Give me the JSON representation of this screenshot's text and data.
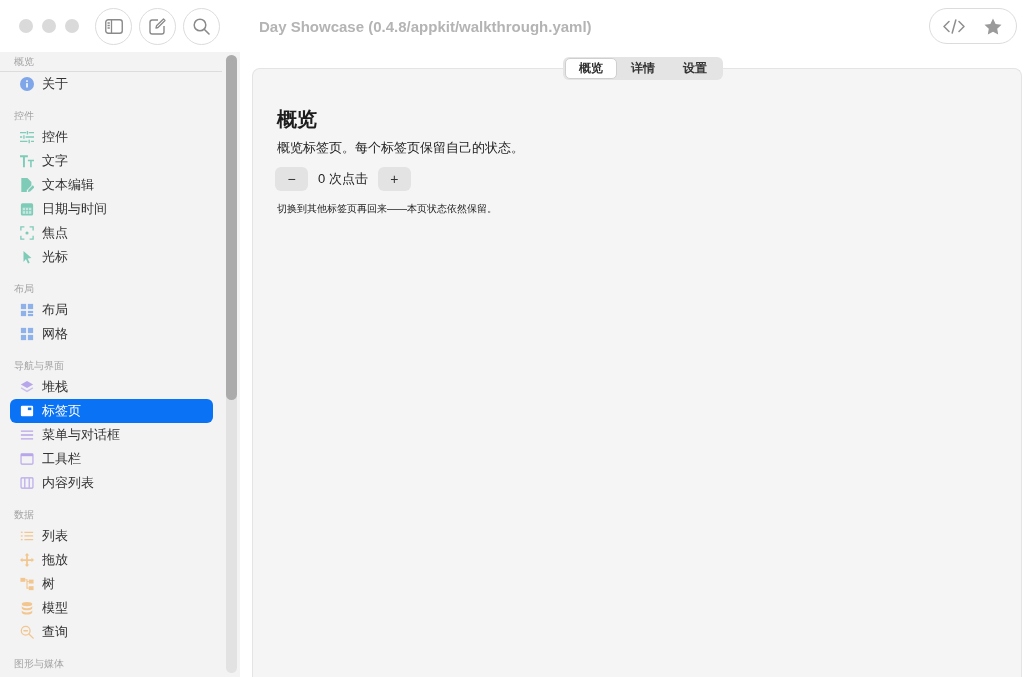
{
  "window": {
    "title": "Day Showcase (0.4.8/appkit/walkthrough.yaml)"
  },
  "sidebar": {
    "sections": [
      {
        "title": "概览",
        "color": "#7ea6e9",
        "items": [
          {
            "label": "关于",
            "selected": false
          }
        ]
      },
      {
        "title": "控件",
        "color": "#7ecbb8",
        "items": [
          {
            "label": "控件",
            "selected": false
          },
          {
            "label": "文字",
            "selected": false
          },
          {
            "label": "文本编辑",
            "selected": false
          },
          {
            "label": "日期与时间",
            "selected": false
          },
          {
            "label": "焦点",
            "selected": false
          },
          {
            "label": "光标",
            "selected": false
          }
        ]
      },
      {
        "title": "布局",
        "color": "#8fb1ea",
        "items": [
          {
            "label": "布局",
            "selected": false
          },
          {
            "label": "网格",
            "selected": false
          }
        ]
      },
      {
        "title": "导航与界面",
        "color": "#b7a6ea",
        "items": [
          {
            "label": "堆栈",
            "selected": false
          },
          {
            "label": "标签页",
            "selected": true
          },
          {
            "label": "菜单与对话框",
            "selected": false
          },
          {
            "label": "工具栏",
            "selected": false
          },
          {
            "label": "内容列表",
            "selected": false
          }
        ]
      },
      {
        "title": "数据",
        "color": "#f2c690",
        "items": [
          {
            "label": "列表",
            "selected": false
          },
          {
            "label": "拖放",
            "selected": false
          },
          {
            "label": "树",
            "selected": false
          },
          {
            "label": "模型",
            "selected": false
          },
          {
            "label": "查询",
            "selected": false
          }
        ]
      },
      {
        "title": "图形与媒体"
      }
    ]
  },
  "tabs": [
    {
      "label": "概览",
      "selected": true
    },
    {
      "label": "详情",
      "selected": false
    },
    {
      "label": "设置",
      "selected": false
    }
  ],
  "content": {
    "heading": "概览",
    "description": "概览标签页。每个标签页保留自己的状态。",
    "counter": {
      "decrement": "−",
      "count": "0 次点击",
      "increment": "+"
    },
    "note": "切换到其他标签页再回来——本页状态依然保留。"
  }
}
